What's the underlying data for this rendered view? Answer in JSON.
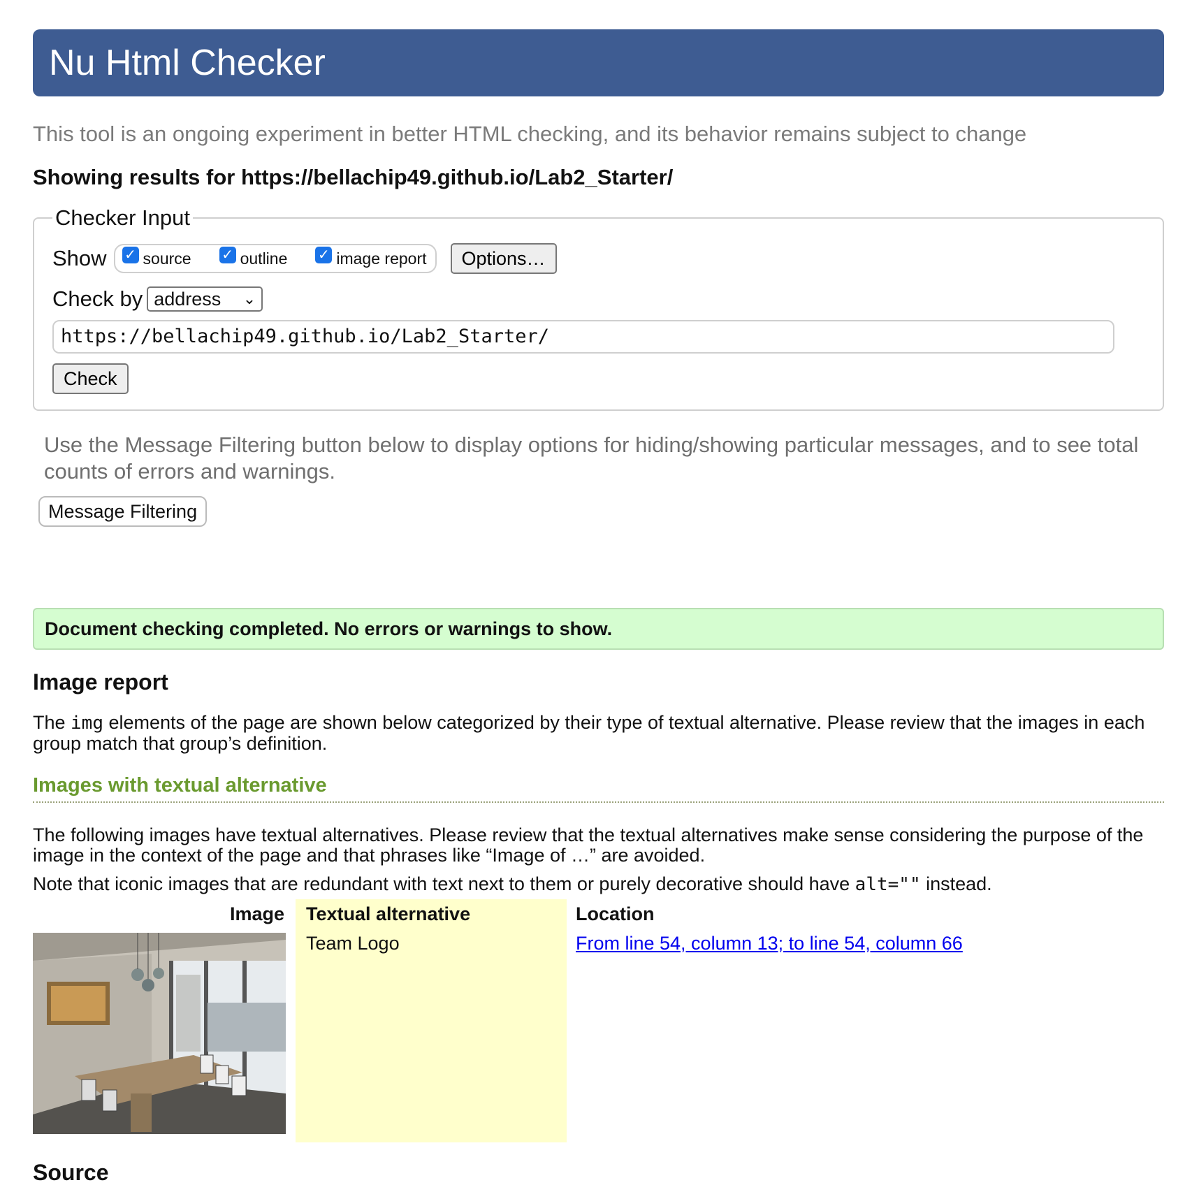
{
  "header": {
    "title": "Nu Html Checker"
  },
  "tagline": "This tool is an ongoing experiment in better HTML checking, and its behavior remains subject to change",
  "results_heading": "Showing results for https://bellachip49.github.io/Lab2_Starter/",
  "checker_input": {
    "legend": "Checker Input",
    "show_label": "Show",
    "checkboxes": [
      {
        "label": "source",
        "checked": true
      },
      {
        "label": "outline",
        "checked": true
      },
      {
        "label": "image report",
        "checked": true
      }
    ],
    "options_button": "Options…",
    "check_by_label": "Check by",
    "check_by_value": "address",
    "url_value": "https://bellachip49.github.io/Lab2_Starter/",
    "check_button": "Check"
  },
  "filter_note": "Use the Message Filtering button below to display options for hiding/showing particular messages, and to see total counts of errors and warnings.",
  "message_filtering_button": "Message Filtering",
  "success_message": "Document checking completed. No errors or warnings to show.",
  "image_report": {
    "heading": "Image report",
    "desc_pre": "The ",
    "desc_code": "img",
    "desc_post": " elements of the page are shown below categorized by their type of textual alternative. Please review that the images in each group match that group’s definition.",
    "group_heading": "Images with textual alternative",
    "group_desc": "The following images have textual alternatives. Please review that the textual alternatives make sense considering the purpose of the image in the context of the page and that phrases like “Image of …” are avoided.",
    "note_pre": "Note that iconic images that are redundant with text next to them or purely decorative should have ",
    "note_code": "alt=\"\"",
    "note_post": " instead.",
    "columns": {
      "image": "Image",
      "alt": "Textual alternative",
      "location": "Location"
    },
    "rows": [
      {
        "alt": "Team Logo",
        "location": "From line 54, column 13; to line 54, column 66"
      }
    ]
  },
  "source_heading": "Source",
  "colors": {
    "header_bg": "#3e5c92",
    "success_bg": "#d5fdd0",
    "alt_col_bg": "#ffffcc",
    "group_heading": "#6a9a2f",
    "link": "#0000ee"
  }
}
